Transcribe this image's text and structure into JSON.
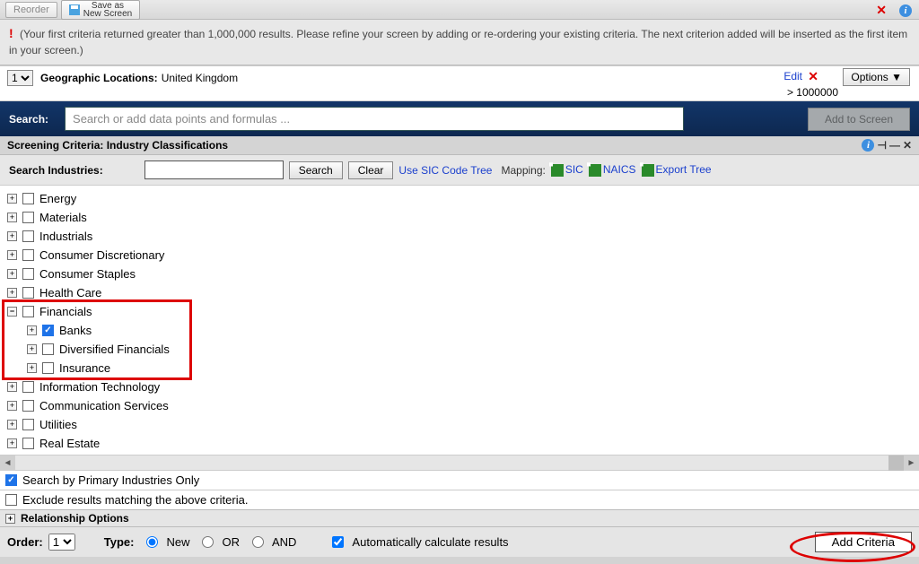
{
  "toolbar": {
    "reorder": "Reorder",
    "save_line1": "Save as",
    "save_line2": "New Screen"
  },
  "warning": "(Your first criteria returned greater than 1,000,000 results. Please refine your screen by adding or re-ordering your existing criteria. The next criterion added will be inserted as the first item in your screen.)",
  "criteria_row": {
    "order": "1",
    "label": "Geographic Locations:",
    "value": "United Kingdom",
    "edit": "Edit",
    "options": "Options ▼",
    "count": "> 1000000"
  },
  "search": {
    "label": "Search:",
    "placeholder": "Search or add data points and formulas ...",
    "add_btn": "Add to Screen"
  },
  "section": {
    "title": "Screening Criteria: Industry Classifications"
  },
  "subbar": {
    "label": "Search Industries:",
    "search_btn": "Search",
    "clear_btn": "Clear",
    "use_sic": "Use SIC Code Tree",
    "mapping": "Mapping:",
    "sic": "SIC",
    "naics": "NAICS",
    "export": "Export Tree"
  },
  "tree": [
    {
      "label": "Energy",
      "checked": false,
      "expanded": false
    },
    {
      "label": "Materials",
      "checked": false,
      "expanded": false
    },
    {
      "label": "Industrials",
      "checked": false,
      "expanded": false
    },
    {
      "label": "Consumer Discretionary",
      "checked": false,
      "expanded": false
    },
    {
      "label": "Consumer Staples",
      "checked": false,
      "expanded": false
    },
    {
      "label": "Health Care",
      "checked": false,
      "expanded": false
    },
    {
      "label": "Financials",
      "checked": false,
      "expanded": true,
      "children": [
        {
          "label": "Banks",
          "checked": true
        },
        {
          "label": "Diversified Financials",
          "checked": false
        },
        {
          "label": "Insurance",
          "checked": false
        }
      ]
    },
    {
      "label": "Information Technology",
      "checked": false,
      "expanded": false
    },
    {
      "label": "Communication Services",
      "checked": false,
      "expanded": false
    },
    {
      "label": "Utilities",
      "checked": false,
      "expanded": false
    },
    {
      "label": "Real Estate",
      "checked": false,
      "expanded": false
    }
  ],
  "checks": {
    "primary": "Search by Primary Industries Only",
    "exclude": "Exclude results matching the above criteria."
  },
  "rel": "Relationship Options",
  "bottom": {
    "order_label": "Order:",
    "order_val": "1",
    "type_label": "Type:",
    "new": "New",
    "or": "OR",
    "and": "AND",
    "auto": "Automatically calculate results",
    "add_crit": "Add Criteria"
  }
}
